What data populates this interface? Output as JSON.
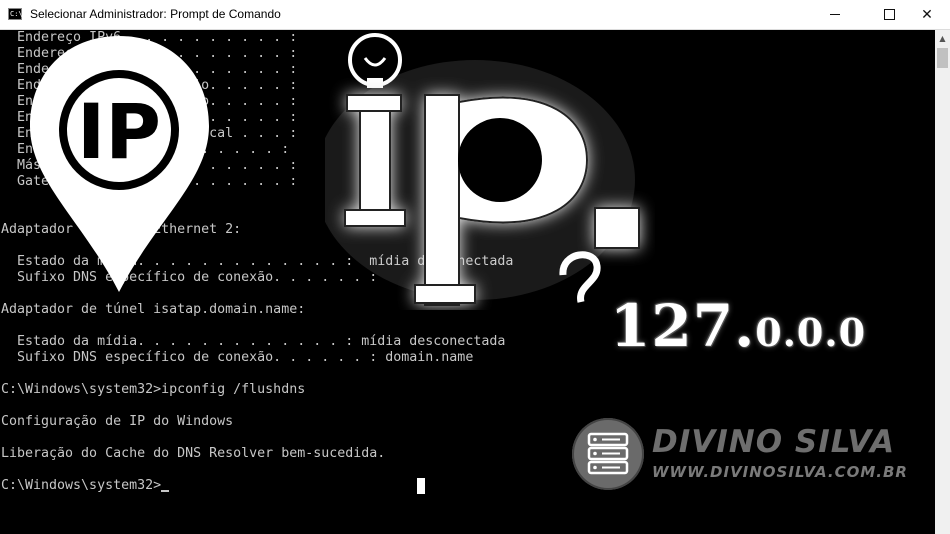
{
  "window": {
    "title": "Selecionar Administrador: Prompt de Comando",
    "app_icon_text": "C:\\",
    "minimize_icon": "minimize-icon",
    "maximize_icon": "maximize-icon",
    "close_glyph": "✕"
  },
  "console": {
    "text": "  Endereço IPv6 . . . . . . . . . . :\n  Endereço IPv6 . . . . . . . . . . :\n  Endereço IPv6 . . . . . . . . . . :\n  Endereço IPv6 Temporário. . . . . :\n  Endereço IPv6 Temporário. . . . . :\n  Endereço IPv6 Temporário. . . . . :\n  Endereço IPv6 de link local . . . :\n  Endereço IPv4. . . . . . . . . . :\n  Máscara de Sub-rede . . . . . . . :\n  Gateway Padrão. . . . . . . . . . :\n\n\nAdaptador Ethernet Ethernet 2:\n\n  Estado da mídia. . . . . . . . . . . . . :  mídia desconectada\n  Sufixo DNS específico de conexão. . . . . . :\n\nAdaptador de túnel isatap.domain.name:\n\n  Estado da mídia. . . . . . . . . . . . . : mídia desconectada\n  Sufixo DNS específico de conexão. . . . . . : domain.name\n\nC:\\Windows\\system32>ipconfig /flushdns\n\nConfiguração de IP do Windows\n\nLiberação do Cache do DNS Resolver bem-sucedida.\n\nC:\\Windows\\system32>"
  },
  "artwork": {
    "ip_number_main": "127.",
    "ip_number_tail": "0.0.0",
    "brand_name": "DIVINO SILVA",
    "brand_url": "WWW.DIVINOSILVA.COM.BR",
    "pin_icon": "location-pin-icon",
    "bulb_icon": "lightbulb-icon",
    "server_icon": "server-icon"
  },
  "colors": {
    "console_bg": "#000000",
    "console_text": "#c7c7c7",
    "titlebar_bg": "#ffffff"
  }
}
